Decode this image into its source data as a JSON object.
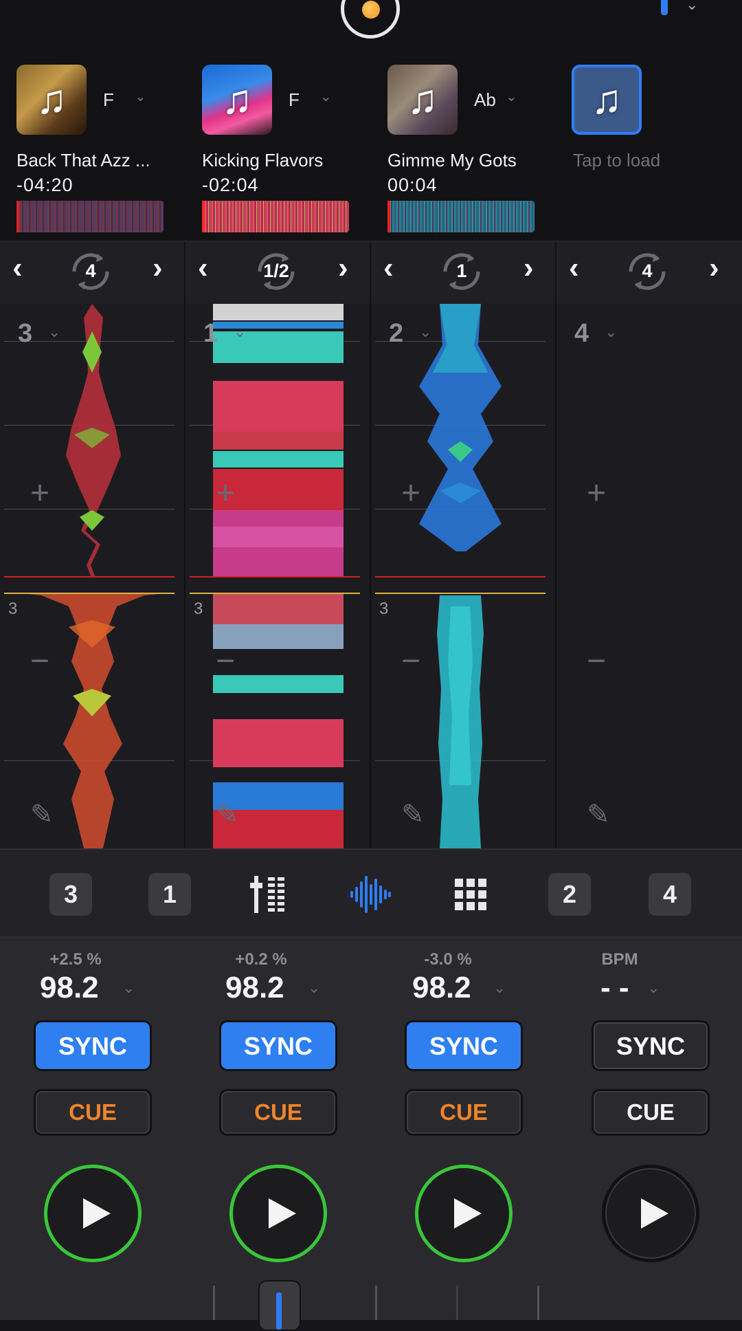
{
  "decks": [
    {
      "title": "Back That Azz ...",
      "time": "-04:20",
      "key": "F",
      "loop": "4",
      "deck_num": "3",
      "beat": "3",
      "pitch": "+2.5 %",
      "bpm": "98.2",
      "sync": "SYNC",
      "cue": "CUE",
      "sync_on": true,
      "cue_color": "#f0842a",
      "playing": true
    },
    {
      "title": "Kicking Flavors",
      "time": "-02:04",
      "key": "F",
      "loop": "1/2",
      "deck_num": "1",
      "beat": "3",
      "pitch": "+0.2 %",
      "bpm": "98.2",
      "sync": "SYNC",
      "cue": "CUE",
      "sync_on": true,
      "cue_color": "#f0842a",
      "playing": true
    },
    {
      "title": "Gimme My Gots",
      "time": "00:04",
      "key": "Ab",
      "loop": "1",
      "deck_num": "2",
      "beat": "3",
      "pitch": "-3.0 %",
      "bpm": "98.2",
      "sync": "SYNC",
      "cue": "CUE",
      "sync_on": true,
      "cue_color": "#f0842a",
      "playing": true
    },
    {
      "title": "Tap to load",
      "time": "",
      "key": "",
      "loop": "4",
      "deck_num": "4",
      "beat": "",
      "pitch": "BPM",
      "bpm": "- -",
      "sync": "SYNC",
      "cue": "CUE",
      "sync_on": false,
      "cue_color": "#f4f4f4",
      "playing": false
    }
  ],
  "selector": {
    "left_decks": [
      "3",
      "1"
    ],
    "right_decks": [
      "2",
      "4"
    ],
    "icons": [
      "mixer-icon",
      "waveform-icon",
      "pads-grid-icon"
    ]
  },
  "colors": {
    "accent": "#2f7df6",
    "play_ring": "#38c638",
    "cue": "#f0842a",
    "playhead": "#ff2525"
  }
}
